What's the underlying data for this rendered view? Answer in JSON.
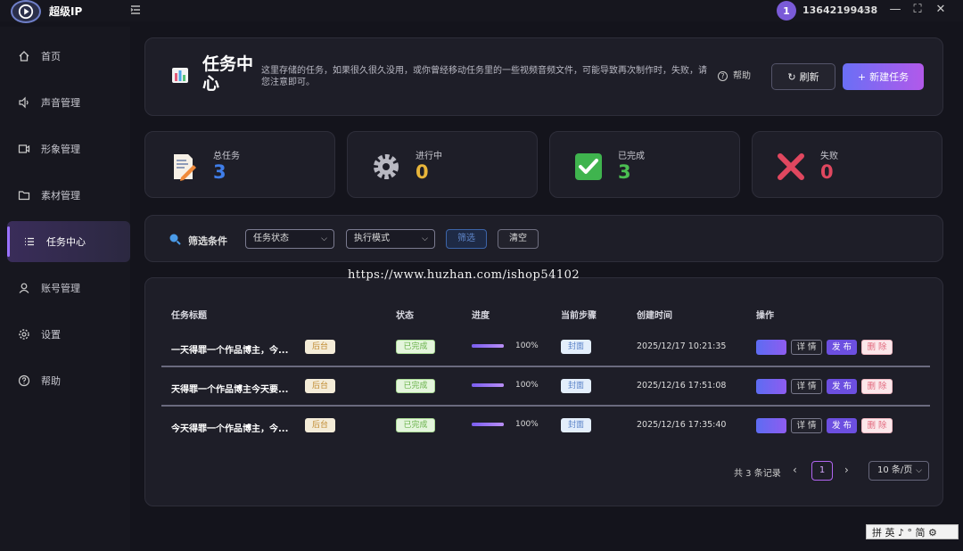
{
  "app": {
    "name": "超级IP"
  },
  "user": {
    "avatar_letter": "1",
    "phone": "13642199438"
  },
  "window": {
    "minimize": "—",
    "maximize": "⛶",
    "close": "✕"
  },
  "sidebar": {
    "items": [
      {
        "label": "首页",
        "icon": "home-icon"
      },
      {
        "label": "声音管理",
        "icon": "speaker-icon"
      },
      {
        "label": "形象管理",
        "icon": "video-icon"
      },
      {
        "label": "素材管理",
        "icon": "folder-icon"
      },
      {
        "label": "任务中心",
        "icon": "list-icon",
        "active": true
      },
      {
        "label": "账号管理",
        "icon": "user-icon"
      },
      {
        "label": "设置",
        "icon": "gear-icon"
      },
      {
        "label": "帮助",
        "icon": "help-icon"
      }
    ]
  },
  "header": {
    "title": "任务中心",
    "description": "这里存储的任务，如果很久很久没用，或你曾经移动任务里的一些视频音频文件，可能导致再次制作时，失败，请您注意即可。",
    "help_label": "帮助",
    "refresh_label": "刷新",
    "new_task_label": "新建任务"
  },
  "stats": [
    {
      "label": "总任务",
      "value": "3",
      "color": "#3f7de8",
      "icon": "document-edit-icon"
    },
    {
      "label": "进行中",
      "value": "0",
      "color": "#e8b53a",
      "icon": "gear-icon"
    },
    {
      "label": "已完成",
      "value": "3",
      "color": "#4bbe52",
      "icon": "check-icon"
    },
    {
      "label": "失败",
      "value": "0",
      "color": "#e0475f",
      "icon": "cross-icon"
    }
  ],
  "filter": {
    "label": "筛选条件",
    "status_select": "任务状态",
    "mode_select": "执行模式",
    "filter_button": "筛选",
    "clear_button": "清空"
  },
  "table": {
    "headers": [
      "任务标题",
      "状态",
      "进度",
      "当前步骤",
      "创建时间",
      "操作"
    ],
    "rows": [
      {
        "title": "一天得罪一个作品博主，今...",
        "mode": "后台",
        "status": "已完成",
        "progress": 100,
        "progress_label": "100%",
        "step": "封面",
        "created": "2025/12/17 10:21:35"
      },
      {
        "title": "天得罪一个作品博主今天要...",
        "mode": "后台",
        "status": "已完成",
        "progress": 100,
        "progress_label": "100%",
        "step": "封面",
        "created": "2025/12/16 17:51:08"
      },
      {
        "title": "今天得罪一个作品博主，今...",
        "mode": "后台",
        "status": "已完成",
        "progress": 100,
        "progress_label": "100%",
        "step": "封面",
        "created": "2025/12/16 17:35:40"
      }
    ],
    "actions": {
      "detail": "详 情",
      "publish": "发 布",
      "delete": "删 除"
    }
  },
  "pagination": {
    "total": "共 3 条记录",
    "current": "1",
    "page_size": "10 条/页"
  },
  "watermark": "https://www.huzhan.com/ishop54102",
  "ime_bar": "拼 英 ♪ ° 简 ⚙"
}
